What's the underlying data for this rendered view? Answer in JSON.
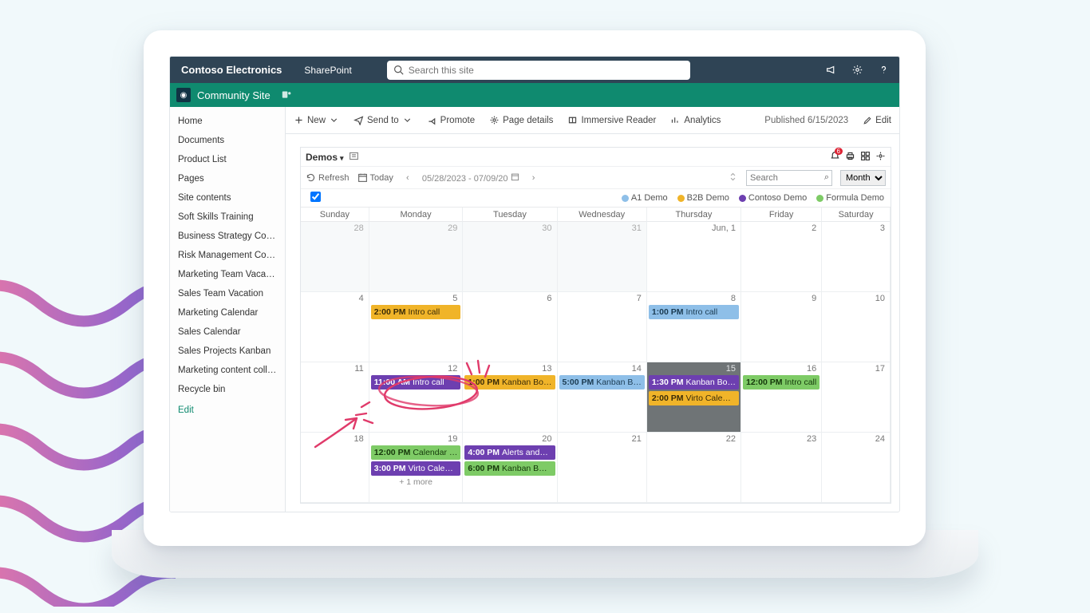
{
  "colors": {
    "blue": "#8ebfe8",
    "orange": "#f0b429",
    "purple": "#6d3fb0",
    "green": "#7ecb66"
  },
  "topbar": {
    "brand": "Contoso Electronics",
    "app": "SharePoint",
    "search_placeholder": "Search this site"
  },
  "sitebar": {
    "title": "Community Site"
  },
  "leftnav": {
    "items": [
      "Home",
      "Documents",
      "Product List",
      "Pages",
      "Site contents",
      "Soft Skills Training",
      "Business Strategy Cours…",
      "Risk Management Cour…",
      "Marketing Team Vacation",
      "Sales Team Vacation",
      "Marketing Calendar",
      "Sales Calendar",
      "Sales Projects Kanban",
      "Marketing content colle…",
      "Recycle bin"
    ],
    "edit": "Edit"
  },
  "cmdbar": {
    "new": "New",
    "sendto": "Send to",
    "promote": "Promote",
    "pagedetails": "Page details",
    "immersive": "Immersive Reader",
    "analytics": "Analytics",
    "published": "Published 6/15/2023",
    "edit": "Edit"
  },
  "calendar": {
    "title": "Demos",
    "refresh": "Refresh",
    "today": "Today",
    "range": "05/28/2023 - 07/09/20",
    "search_placeholder": "Search",
    "view": "Month",
    "bell_badge": "6",
    "legend": [
      {
        "label": "A1 Demo",
        "color": "blue"
      },
      {
        "label": "B2B Demo",
        "color": "orange"
      },
      {
        "label": "Contoso Demo",
        "color": "purple"
      },
      {
        "label": "Formula Demo",
        "color": "green"
      }
    ],
    "dayheaders": [
      "Sunday",
      "Monday",
      "Tuesday",
      "Wednesday",
      "Thursday",
      "Friday",
      "Saturday"
    ],
    "weeks": [
      {
        "dates": [
          "28",
          "29",
          "30",
          "31",
          "Jun, 1",
          "2",
          "3"
        ],
        "off": [
          0,
          1,
          2,
          3
        ]
      },
      {
        "dates": [
          "4",
          "5",
          "6",
          "7",
          "8",
          "9",
          "10"
        ]
      },
      {
        "dates": [
          "11",
          "12",
          "13",
          "14",
          "15",
          "16",
          "17"
        ],
        "grey": [
          4
        ]
      },
      {
        "dates": [
          "18",
          "19",
          "20",
          "21",
          "22",
          "23",
          "24"
        ]
      }
    ],
    "events": {
      "w1": {
        "mon": {
          "time": "2:00 PM",
          "title": "Intro call",
          "color": "orange"
        },
        "thu": {
          "time": "1:00 PM",
          "title": "Intro call",
          "color": "blue"
        }
      },
      "w2": {
        "mon": {
          "time": "11:00 AM",
          "title": "Intro call",
          "color": "purple"
        },
        "tue": {
          "time": "1:00 PM",
          "title": "Kanban Bo…",
          "color": "orange"
        },
        "wed": {
          "time": "5:00 PM",
          "title": "Kanban B…",
          "color": "blue"
        },
        "thu_a": {
          "time": "1:30 PM",
          "title": "Kanban Bo…",
          "color": "purple"
        },
        "thu_b": {
          "time": "2:00 PM",
          "title": "Virto Cale…",
          "color": "orange"
        },
        "fri": {
          "time": "12:00 PM",
          "title": "Intro call",
          "color": "green"
        }
      },
      "w3": {
        "mon_a": {
          "time": "12:00 PM",
          "title": "Calendar …",
          "color": "green"
        },
        "mon_b": {
          "time": "3:00 PM",
          "title": "Virto Cale…",
          "color": "purple"
        },
        "tue_a": {
          "time": "4:00 PM",
          "title": "Alerts and…",
          "color": "purple"
        },
        "tue_b": {
          "time": "6:00 PM",
          "title": "Kanban B…",
          "color": "green"
        },
        "more": "+ 1 more"
      }
    }
  }
}
